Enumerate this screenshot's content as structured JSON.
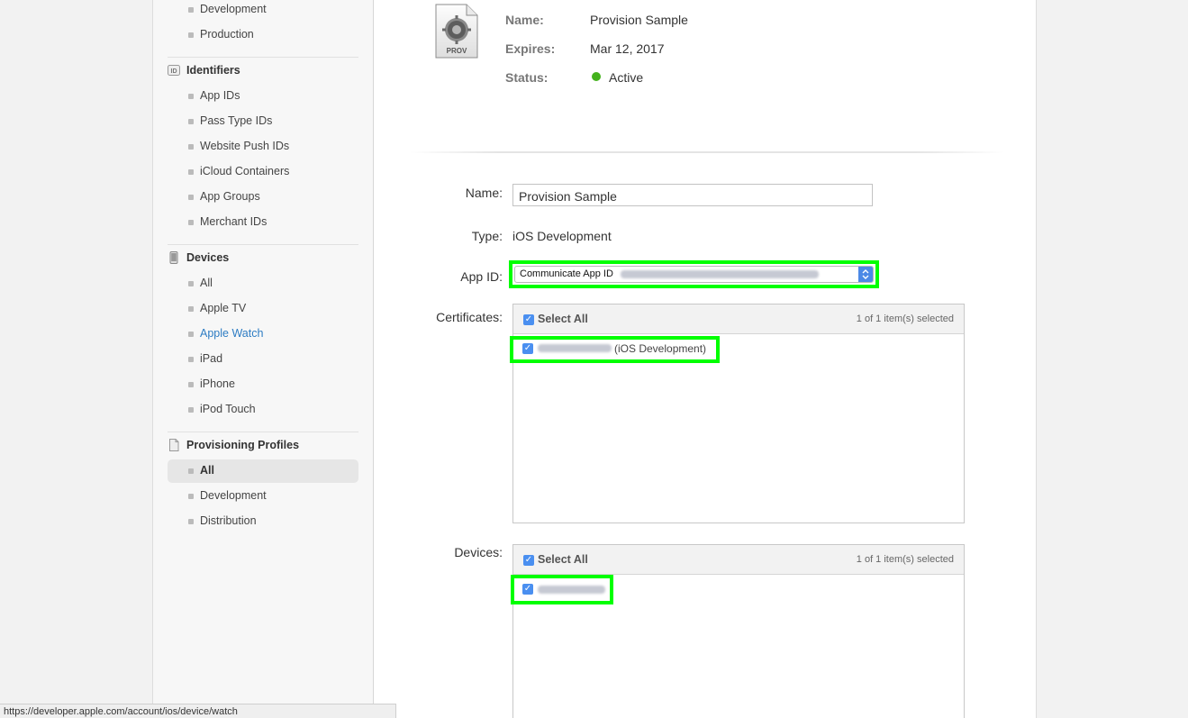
{
  "sidebar": {
    "certificates_items": [
      {
        "label": "Development"
      },
      {
        "label": "Production"
      }
    ],
    "identifiers": {
      "title": "Identifiers",
      "icon": "id-icon",
      "items": [
        {
          "label": "App IDs"
        },
        {
          "label": "Pass Type IDs"
        },
        {
          "label": "Website Push IDs"
        },
        {
          "label": "iCloud Containers"
        },
        {
          "label": "App Groups"
        },
        {
          "label": "Merchant IDs"
        }
      ]
    },
    "devices": {
      "title": "Devices",
      "icon": "device-icon",
      "items": [
        {
          "label": "All"
        },
        {
          "label": "Apple TV"
        },
        {
          "label": "Apple Watch"
        },
        {
          "label": "iPad"
        },
        {
          "label": "iPhone"
        },
        {
          "label": "iPod Touch"
        }
      ]
    },
    "profiles": {
      "title": "Provisioning Profiles",
      "icon": "document-icon",
      "items": [
        {
          "label": "All"
        },
        {
          "label": "Development"
        },
        {
          "label": "Distribution"
        }
      ]
    }
  },
  "summary": {
    "icon_label": "PROV",
    "name_label": "Name:",
    "name_value": "Provision Sample",
    "expires_label": "Expires:",
    "expires_value": "Mar 12, 2017",
    "status_label": "Status:",
    "status_value": "Active",
    "status_color": "#44b21d"
  },
  "form": {
    "name_label": "Name:",
    "name_value": "Provision Sample",
    "type_label": "Type:",
    "type_value": "iOS Development",
    "appid_label": "App ID:",
    "appid_value": "Communicate App ID",
    "certificates_label": "Certificates:",
    "certificates": {
      "select_all": "Select All",
      "count": "1 of 1 item(s) selected",
      "item_suffix": "(iOS Development)"
    },
    "devices_label": "Devices:",
    "devices": {
      "select_all": "Select All",
      "count": "1 of 1 item(s) selected"
    }
  },
  "statusbar": {
    "url": "https://developer.apple.com/account/ios/device/watch"
  },
  "colors": {
    "highlight": "#00ff00",
    "link": "#2d7cc3",
    "checkbox": "#4a8ff0"
  }
}
